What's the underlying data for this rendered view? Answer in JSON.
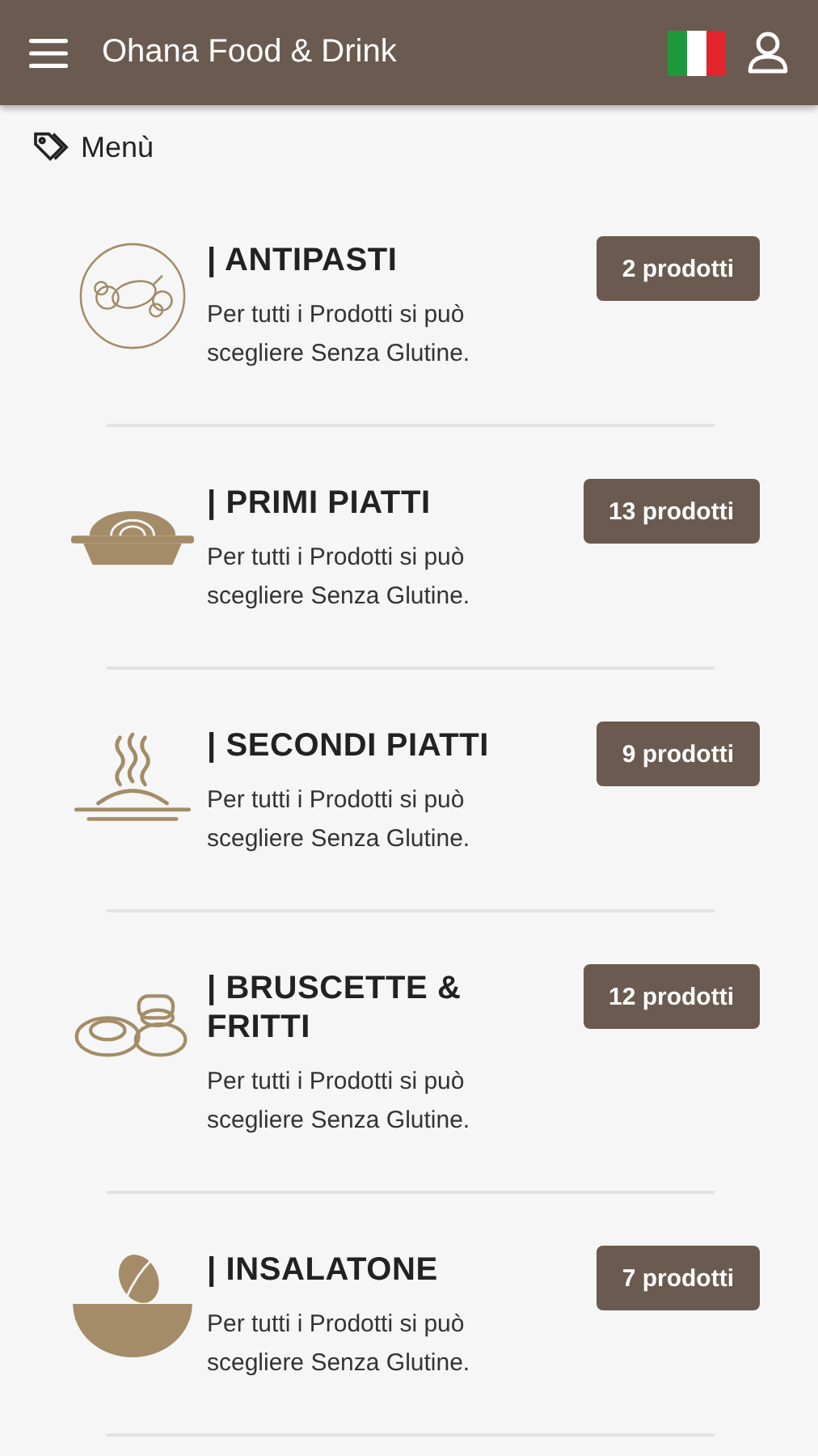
{
  "header": {
    "title": "Ohana Food & Drink"
  },
  "breadcrumb": {
    "label": "Menù"
  },
  "categories": [
    {
      "title": "| ANTIPASTI",
      "description": "Per tutti i Prodotti si può scegliere Senza Glutine.",
      "count": "2 prodotti"
    },
    {
      "title": "| PRIMI PIATTI",
      "description": "Per tutti i Prodotti si può scegliere Senza Glutine.",
      "count": "13 prodotti"
    },
    {
      "title": "| SECONDI PIATTI",
      "description": "Per tutti i Prodotti si può scegliere Senza Glutine.",
      "count": "9 prodotti"
    },
    {
      "title": "| BRUSCETTE & FRITTI",
      "description": "Per tutti i Prodotti si può scegliere Senza Glutine.",
      "count": "12 prodotti"
    },
    {
      "title": "| INSALATONE",
      "description": "Per tutti i Prodotti si può scegliere Senza Glutine.",
      "count": "7 prodotti"
    }
  ]
}
